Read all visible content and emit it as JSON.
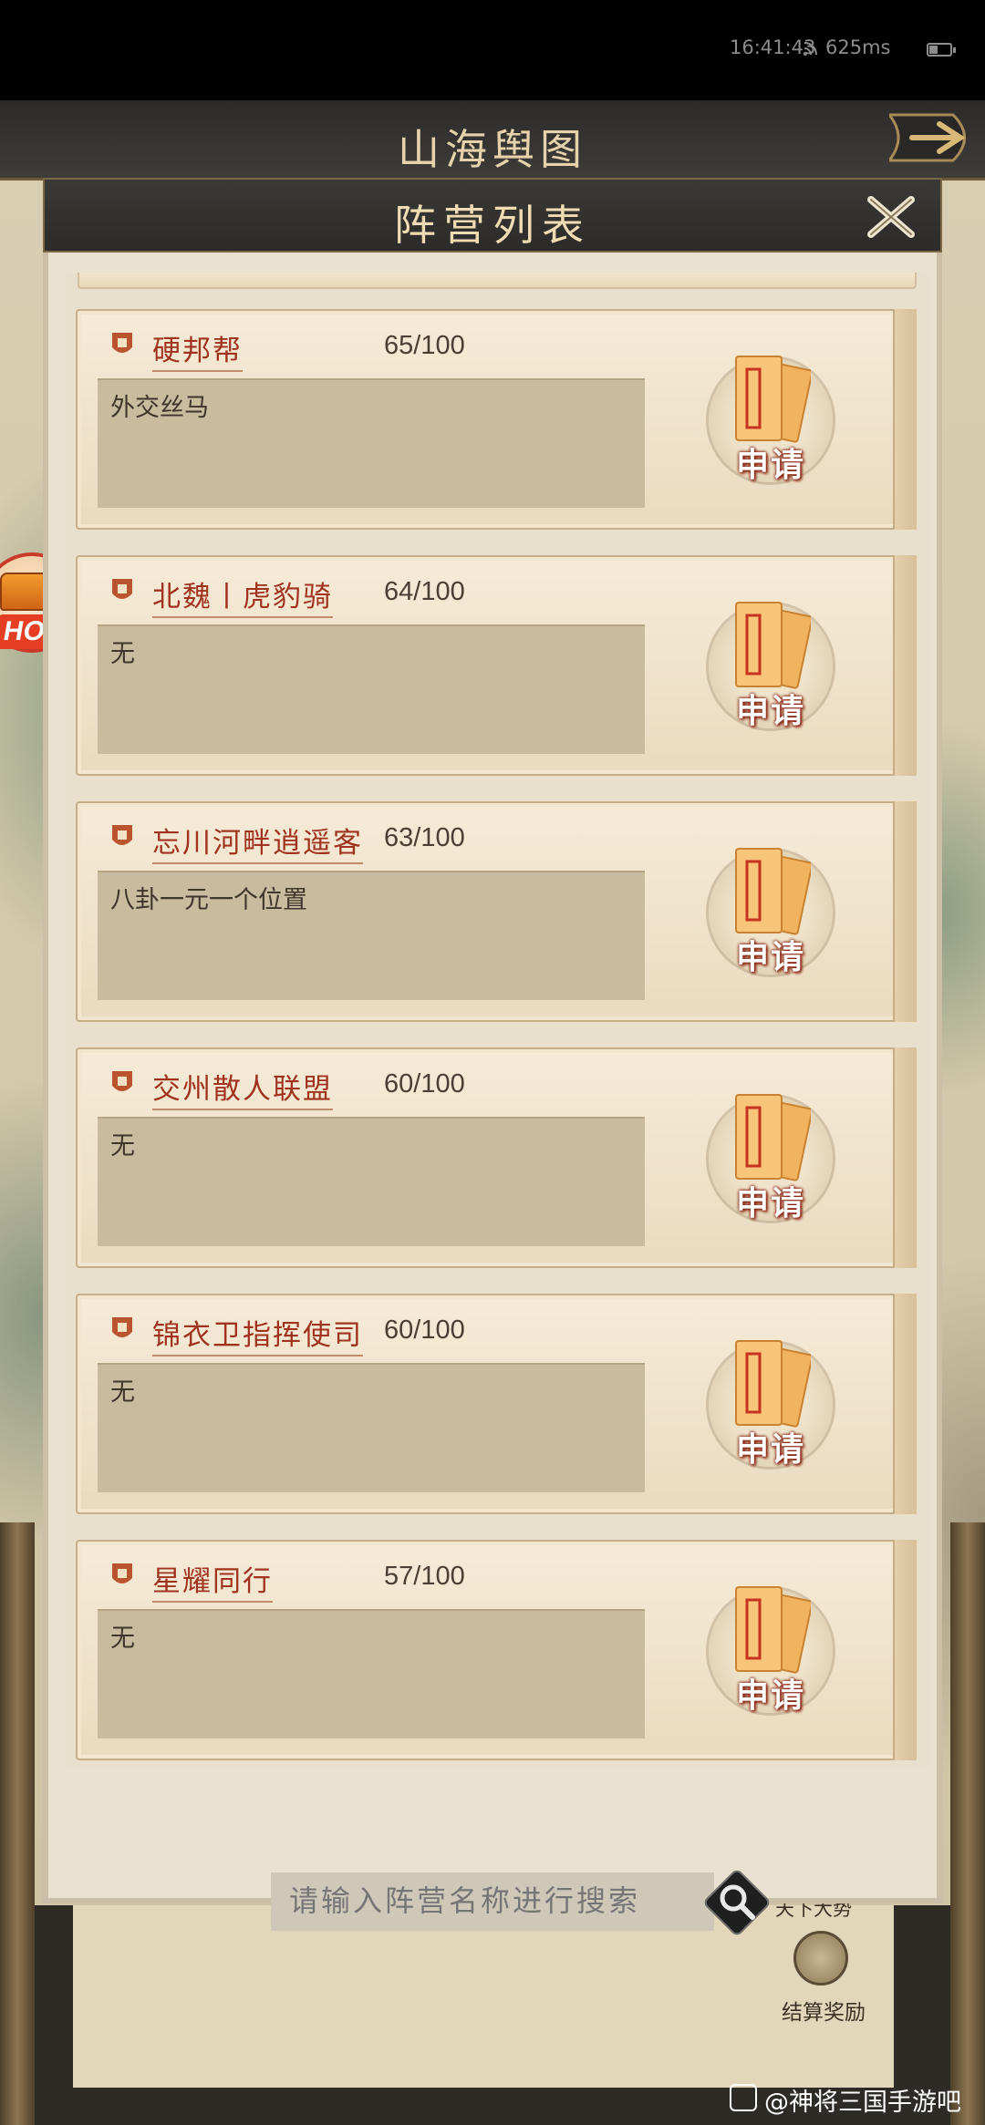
{
  "status_bar": {
    "time": "16:41:43",
    "ping": "625ms"
  },
  "map": {
    "title": "山海舆图",
    "world_label": "天下大势",
    "settle_reward_label": "结算奖励"
  },
  "hot_badge": {
    "label": "HOT"
  },
  "dialog": {
    "title": "阵营列表"
  },
  "camps": [
    {
      "name": "硬邦帮",
      "count": "65/100",
      "description": "外交丝马",
      "apply_label": "申请"
    },
    {
      "name": "北魏丨虎豹骑",
      "count": "64/100",
      "description": "无",
      "apply_label": "申请"
    },
    {
      "name": "忘川河畔逍遥客",
      "count": "63/100",
      "description": "八卦一元一个位置",
      "apply_label": "申请"
    },
    {
      "name": "交州散人联盟",
      "count": "60/100",
      "description": "无",
      "apply_label": "申请"
    },
    {
      "name": "锦衣卫指挥使司",
      "count": "60/100",
      "description": "无",
      "apply_label": "申请"
    },
    {
      "name": "星耀同行",
      "count": "57/100",
      "description": "无",
      "apply_label": "申请"
    }
  ],
  "search": {
    "placeholder": "请输入阵营名称进行搜索"
  },
  "watermark": {
    "text": "@神将三国手游吧"
  },
  "colors": {
    "accent": "#a0331f",
    "parchment": "#eadbbf",
    "header": "#2d2b29"
  }
}
